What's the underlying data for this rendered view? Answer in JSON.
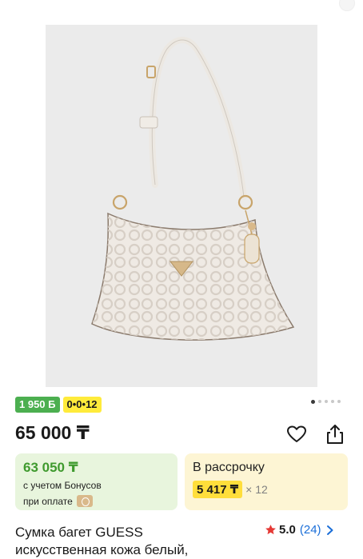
{
  "product": {
    "image_alt": "handbag-image",
    "badge_bonus": "1 950 Б",
    "badge_installment": "0•0•12",
    "price": "65 000 ₸",
    "bonus_card": {
      "price": "63 050 ₸",
      "line1": "с учетом Бонусов",
      "line2": "при оплате"
    },
    "credit_card": {
      "title": "В рассрочку",
      "amount": "5 417 ₸",
      "months": "× 12"
    },
    "title_line1": "Сумка багет GUESS",
    "title_line2": "искусственная кожа белый,",
    "rating": "5.0",
    "reviews": "(24)"
  },
  "carousel": {
    "count": 5,
    "active_index": 0
  },
  "colors": {
    "bonus_green": "#4caf50",
    "installment_yellow": "#ffeb3b",
    "bonus_card_bg": "#e8f5dd",
    "credit_card_bg": "#fdf5d4",
    "price_green": "#3f9a2e",
    "link_blue": "#1a6ed8",
    "star_red": "#e53935"
  },
  "icons": {
    "favorite": "heart-icon",
    "share": "share-icon",
    "rating": "star-icon",
    "more": "chevron-right-icon",
    "payment": "kaspi-pay-icon"
  }
}
